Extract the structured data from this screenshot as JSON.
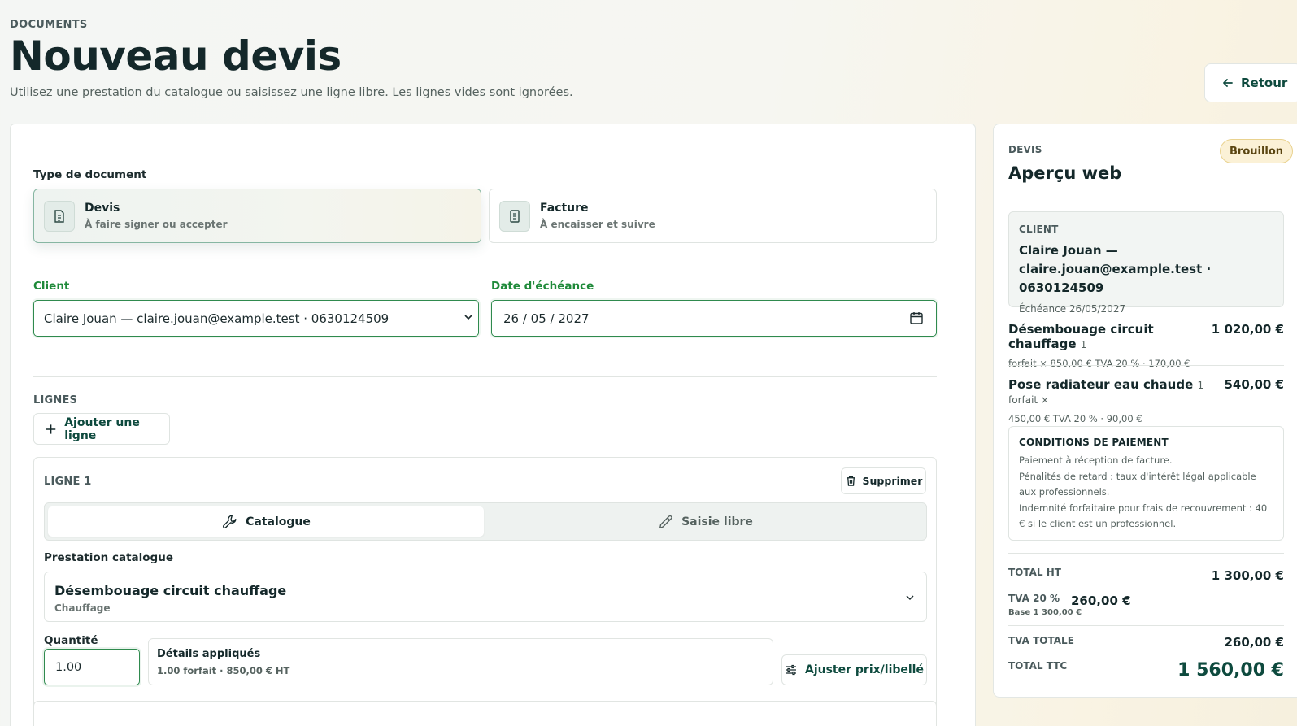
{
  "header": {
    "eyebrow": "DOCUMENTS",
    "title": "Nouveau devis",
    "subtitle": "Utilisez une prestation du catalogue ou saisissez une ligne libre. Les lignes vides sont ignorées.",
    "back_label": "Retour"
  },
  "form": {
    "type_label": "Type de document",
    "types": [
      {
        "title": "Devis",
        "subtitle": "À faire signer ou accepter",
        "selected": true
      },
      {
        "title": "Facture",
        "subtitle": "À encaisser et suivre",
        "selected": false
      }
    ],
    "client_label": "Client",
    "client_value": "Claire Jouan — claire.jouan@example.test · 0630124509",
    "due_label": "Date d'échéance",
    "due_value": "26 / 05 / 2027",
    "lines_label": "LIGNES",
    "add_line_label": "Ajouter une ligne",
    "line": {
      "title": "LIGNE 1",
      "delete_label": "Supprimer",
      "mode_catalogue": "Catalogue",
      "mode_free": "Saisie libre",
      "presta_label": "Prestation catalogue",
      "presta_name": "Désembouage circuit chauffage",
      "presta_category": "Chauffage",
      "qty_label": "Quantité",
      "qty_value": "1.00",
      "details_title": "Détails appliqués",
      "details_text": "1.00 forfait · 850,00 € HT",
      "adjust_label": "Ajuster prix/libellé"
    }
  },
  "preview": {
    "eyebrow": "DEVIS",
    "status": "Brouillon",
    "title": "Aperçu web",
    "client_label": "CLIENT",
    "client_name": "Claire Jouan — claire.jouan@example.test · 0630124509",
    "due": "Échéance 26/05/2027",
    "lines": [
      {
        "name": "Désembouage circuit chauffage",
        "qty_note": "1",
        "amount": "1 020,00 €",
        "detail": "forfait × 850,00 € TVA 20 % · 170,00 €"
      },
      {
        "name": "Pose radiateur eau chaude",
        "qty_note": "1 forfait ×",
        "amount": "540,00 €",
        "detail": "450,00 € TVA 20 % · 90,00 €"
      }
    ],
    "conditions_title": "CONDITIONS DE PAIEMENT",
    "conditions": [
      "Paiement à réception de facture.",
      "Pénalités de retard : taux d'intérêt légal applicable aux professionnels.",
      "Indemnité forfaitaire pour frais de recouvrement : 40 € si le client est un professionnel."
    ],
    "total_ht_label": "TOTAL HT",
    "total_ht": "1 300,00 €",
    "tva_label": "TVA 20 %",
    "tva_base": "Base 1 300,00 €",
    "tva_value": "260,00 €",
    "tva_total_label": "TVA TOTALE",
    "tva_total": "260,00 €",
    "ttc_label": "TOTAL TTC",
    "ttc": "1 560,00 €"
  },
  "colors": {
    "accent": "#0e4a3e",
    "focus_green": "#2f8a4e",
    "badge_bg": "#fbf1d6"
  },
  "icons": [
    "arrow-left-icon",
    "document-icon",
    "invoice-icon",
    "chevron-down-icon",
    "calendar-icon",
    "plus-icon",
    "trash-icon",
    "wrench-icon",
    "pencil-icon",
    "sliders-icon"
  ]
}
